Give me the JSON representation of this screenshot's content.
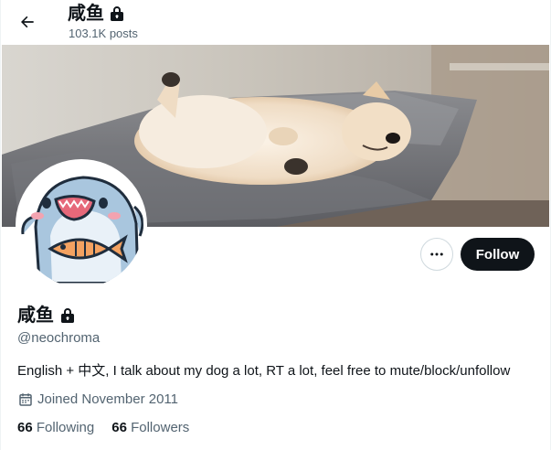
{
  "header": {
    "title": "咸鱼",
    "posts_count": "103.1K posts"
  },
  "profile": {
    "display_name": "咸鱼",
    "handle": "@neochroma",
    "bio": "English + 中文, I talk about my dog a lot, RT a lot, feel free to mute/block/unfollow",
    "joined": "Joined November 2011",
    "following_count": "66",
    "following_label": "Following",
    "followers_count": "66",
    "followers_label": "Followers",
    "protected": true
  },
  "actions": {
    "follow_label": "Follow",
    "more_icon": "more-horizontal-icon"
  },
  "icons": {
    "back": "arrow-left-icon",
    "lock": "lock-icon",
    "calendar": "calendar-icon"
  },
  "colors": {
    "text_primary": "#0f1419",
    "text_secondary": "#536471",
    "follow_button_bg": "#0f1419",
    "follow_button_text": "#ffffff",
    "border": "#cfd9de"
  }
}
